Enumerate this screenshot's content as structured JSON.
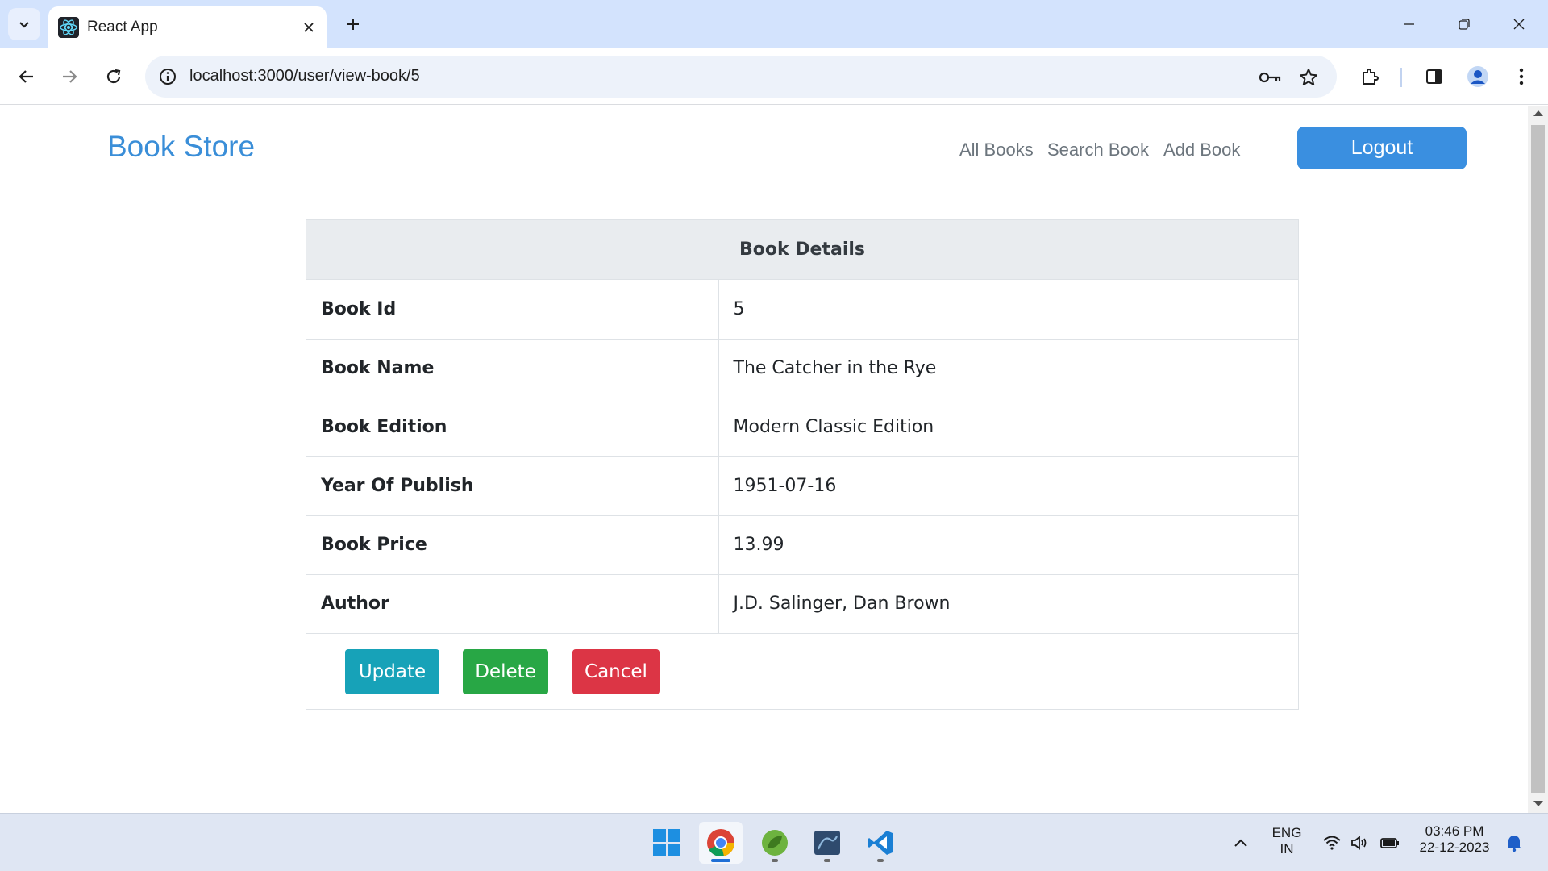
{
  "browser": {
    "tab_title": "React App",
    "url": "localhost:3000/user/view-book/5"
  },
  "navbar": {
    "brand": "Book Store",
    "links": [
      "All Books",
      "Search Book",
      "Add Book"
    ],
    "logout_label": "Logout"
  },
  "card": {
    "header": "Book Details",
    "rows": [
      {
        "label": "Book Id",
        "value": "5"
      },
      {
        "label": "Book Name",
        "value": "The Catcher in the Rye"
      },
      {
        "label": "Book Edition",
        "value": "Modern Classic Edition"
      },
      {
        "label": "Year Of Publish",
        "value": "1951-07-16"
      },
      {
        "label": "Book Price",
        "value": "13.99"
      },
      {
        "label": "Author",
        "value": "J.D. Salinger, Dan Brown"
      }
    ],
    "buttons": {
      "update": "Update",
      "delete": "Delete",
      "cancel": "Cancel"
    }
  },
  "taskbar": {
    "language_line1": "ENG",
    "language_line2": "IN",
    "time": "03:46 PM",
    "date": "22-12-2023"
  },
  "colors": {
    "brand": "#3a8ed8",
    "logout": "#3a8fe0",
    "update": "#17a2b8",
    "delete": "#28a745",
    "cancel": "#dc3545"
  }
}
